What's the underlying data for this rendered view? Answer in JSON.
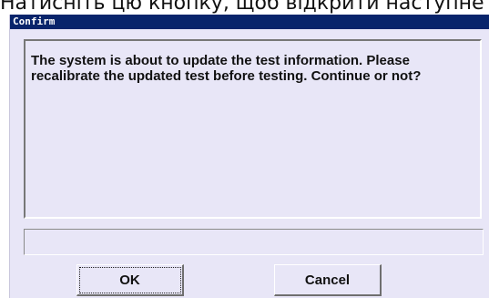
{
  "caption": {
    "text": "Натисніть цю кнопку, щоб відкрити наступне вікно"
  },
  "dialog": {
    "title": "Confirm",
    "message": "The system is about to update the test information. Please recalibrate the updated test before testing. Continue or not?",
    "status_value": "",
    "ok_label": "OK",
    "cancel_label": "Cancel"
  },
  "colors": {
    "titlebar": "#08246b",
    "dialog_background": "#e8e6f7",
    "text": "#111111"
  }
}
